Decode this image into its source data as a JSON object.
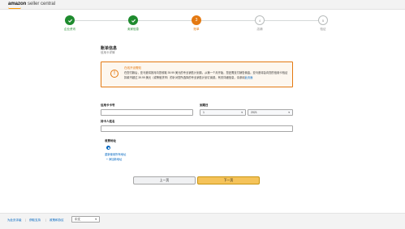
{
  "header": {
    "logo_brand": "amazon",
    "logo_product": "seller central"
  },
  "steps": [
    {
      "label": "企业资讯",
      "state": "done",
      "number": "1"
    },
    {
      "label": "卖家信息",
      "state": "done",
      "number": "2"
    },
    {
      "label": "账单",
      "state": "current",
      "number": "3"
    },
    {
      "label": "店铺",
      "state": "todo",
      "number": "4"
    },
    {
      "label": "验证",
      "state": "todo",
      "number": "5"
    }
  ],
  "billing": {
    "title": "账单信息",
    "subtitle": "信用卡详情",
    "alert": {
      "title": "在线开设需知",
      "text": "在您付款后，亚马逊将按月向您收取 39.99 美元的专业销售计划费。从第一个月开始，您还需支付销售佣金。亚马逊将会向您的信用卡验证扣款不超过 39.99 美元（或等值货币）的针对您所选择的专业销售计划订阅费。有关详细信息，请参阅",
      "link": "此页面"
    },
    "card_number_label": "信用卡卡号",
    "card_number_value": "",
    "expiry_label": "到期日",
    "expiry_month": "1",
    "expiry_year": "2021",
    "holder_label": "持卡人姓名",
    "holder_value": "",
    "billing_address_title": "收费地址",
    "address_link": "重新使用所有地址",
    "add_address_link": "+ 添加新地址"
  },
  "buttons": {
    "prev": "上一页",
    "next": "下一页"
  },
  "footer": {
    "links": [
      "为此页评级",
      "获取支持",
      "政策和协议"
    ],
    "language": "中文"
  },
  "colors": {
    "accent": "#e47911",
    "success": "#1e8b2e",
    "link": "#0066c0",
    "primary_button": "#f5c35a"
  }
}
